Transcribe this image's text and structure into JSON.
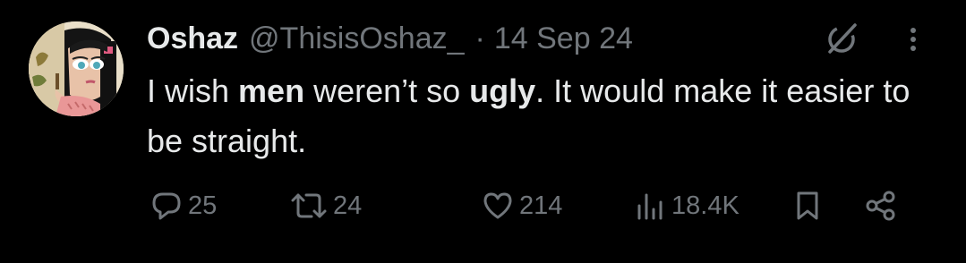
{
  "author": {
    "name": "Oshaz",
    "handle": "@ThisisOshaz_",
    "separator": "·",
    "date": "14 Sep 24"
  },
  "post": {
    "text_1": "I wish ",
    "bold_1": "men",
    "text_2": " weren’t so ",
    "bold_2": "ugly",
    "text_3": ". It would make it easier to be straight."
  },
  "stats": {
    "replies": "25",
    "reposts": "24",
    "likes": "214",
    "views": "18.4K"
  },
  "icons": {
    "grok": "grok-icon",
    "more": "more-options-icon",
    "reply": "reply-icon",
    "repost": "repost-icon",
    "like": "heart-icon",
    "views": "views-icon",
    "bookmark": "bookmark-icon",
    "share": "share-icon"
  },
  "colors": {
    "background": "#000000",
    "text": "#e7e9ea",
    "secondary": "#71767b"
  }
}
